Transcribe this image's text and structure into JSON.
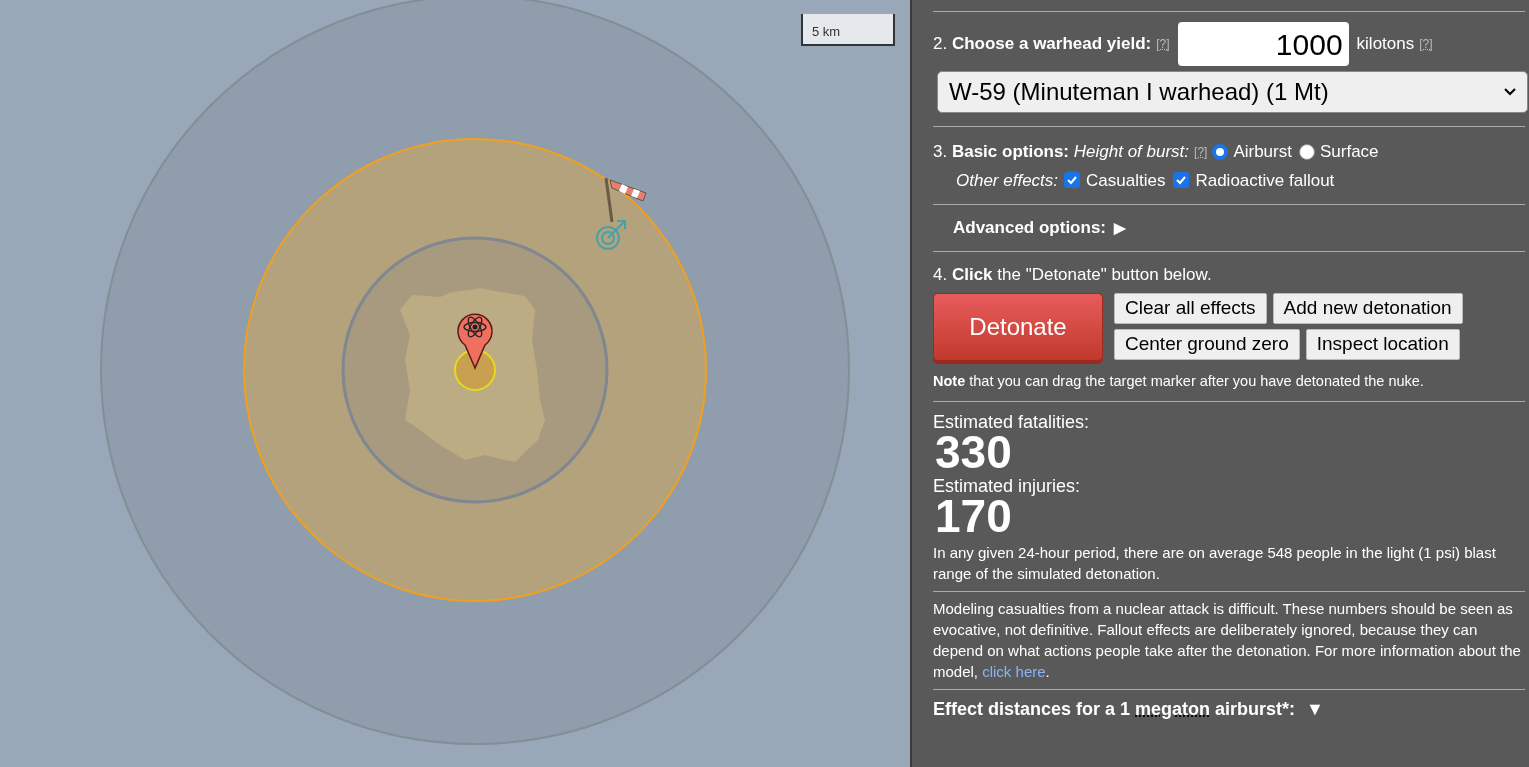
{
  "map": {
    "scale_label": "5 km"
  },
  "yield": {
    "heading": "2. **Choose a warhead yield:**",
    "help": "[?]",
    "value": "1000",
    "unit": "kilotons",
    "unit_help": "[?]"
  },
  "preset_select": {
    "value": "W-59 (Minuteman I warhead) (1 Mt)"
  },
  "basic_options": {
    "heading": "3. **Basic options:** *Height of burst:*",
    "help": "[?]",
    "burst_options": [
      {
        "label": "Airburst",
        "selected": true
      },
      {
        "label": "Surface",
        "selected": false
      }
    ],
    "other_label": "Other effects:",
    "effects": [
      {
        "label": "Casualties",
        "checked": true
      },
      {
        "label": "Radioactive fallout",
        "checked": true
      }
    ]
  },
  "advanced": {
    "label": "Advanced options:",
    "toggle": "▶"
  },
  "detonate": {
    "instruction": "4. **Click** the \"Detonate\" button below.",
    "button": "Detonate",
    "buttons": [
      [
        "Clear all effects",
        "Add new detonation"
      ],
      [
        "Center ground zero",
        "Inspect location"
      ]
    ],
    "note": "**Note** that you can drag the target marker after you have detonated the nuke."
  },
  "results": [
    {
      "label": "Estimated fatalities:",
      "value": "330"
    },
    {
      "label": "Estimated injuries:",
      "value": "170"
    }
  ],
  "population_note": "In any given 24-hour period, there are on average 548 people in the light (1 psi) blast range of the simulated detonation.",
  "disclaimer": {
    "text": "Modeling casualties from a nuclear attack is difficult. These numbers should be seen as evocative, not definitive. Fallout effects are deliberately ignored, because they can depend on what actions people take after the detonation. For more information about the model,",
    "link": "click here",
    "after": "."
  },
  "effect_distances": {
    "prefix": "Effect distances for a 1",
    "term": "megaton",
    "suffix": "airburst*:",
    "toggle": "▼"
  }
}
